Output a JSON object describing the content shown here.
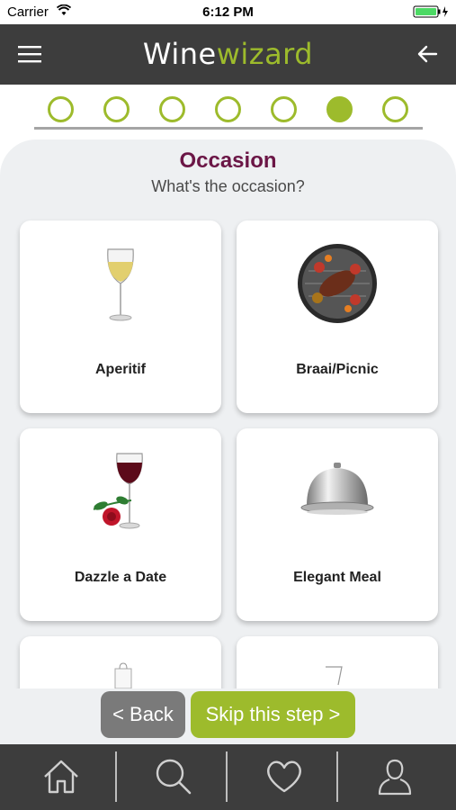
{
  "status_bar": {
    "carrier": "Carrier",
    "time": "6:12 PM"
  },
  "header": {
    "logo_part1": "Wine",
    "logo_part2": "wizard",
    "menu_icon": "hamburger-menu-icon",
    "back_icon": "back-arrow-icon"
  },
  "progress": {
    "total_steps": 7,
    "current_step": 6
  },
  "page": {
    "title": "Occasion",
    "subtitle": "What's the occasion?"
  },
  "options": [
    {
      "label": "Aperitif",
      "icon": "white-wine-glass"
    },
    {
      "label": "Braai/Picnic",
      "icon": "grill"
    },
    {
      "label": "Dazzle a Date",
      "icon": "red-wine-rose"
    },
    {
      "label": "Elegant Meal",
      "icon": "cloche"
    },
    {
      "label": "",
      "icon": "gift-bag"
    },
    {
      "label": "",
      "icon": "glass"
    }
  ],
  "actions": {
    "back_label": "< Back",
    "skip_label": "Skip this step >"
  },
  "tabbar": {
    "items": [
      "home",
      "search",
      "favorites",
      "profile"
    ]
  },
  "colors": {
    "header_bg": "#3d3d3d",
    "accent": "#9dbb2c",
    "title": "#6b1646",
    "panel_bg": "#eef0f2"
  }
}
